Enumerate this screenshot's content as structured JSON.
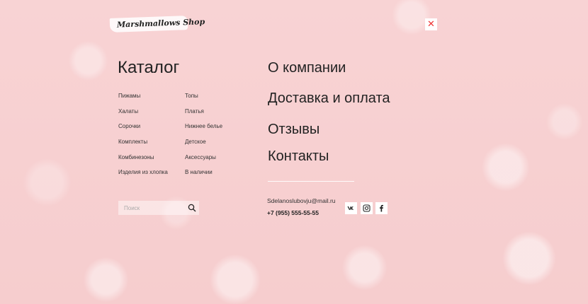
{
  "brand": {
    "logo_text": "Marshmallows Shop"
  },
  "close": {
    "icon": "close-icon",
    "symbol": "✕",
    "color": "#e33333"
  },
  "catalog": {
    "title": "Каталог",
    "col1": [
      "Пижамы",
      "Халаты",
      "Сорочки",
      "Комплекты",
      "Комбинезоны",
      "Изделия из хлопка"
    ],
    "col2": [
      "Топы",
      "Платья",
      "Нижнее белье",
      "Детское",
      "Аксессуары",
      "В наличии"
    ]
  },
  "search": {
    "placeholder": "Поиск",
    "icon": "search-icon"
  },
  "menu": {
    "items": [
      "О компании",
      "Доставка и оплата",
      "Отзывы",
      "Контакты"
    ]
  },
  "contacts": {
    "email": "Sdelanoslubovju@mail.ru",
    "phone": "+7 (955) 555-55-55"
  },
  "social": [
    {
      "name": "vk-icon",
      "label": "VK"
    },
    {
      "name": "instagram-icon",
      "label": "Instagram"
    },
    {
      "name": "facebook-icon",
      "label": "Facebook"
    }
  ],
  "colors": {
    "background": "#f6cfd0",
    "accent": "#e33333"
  }
}
